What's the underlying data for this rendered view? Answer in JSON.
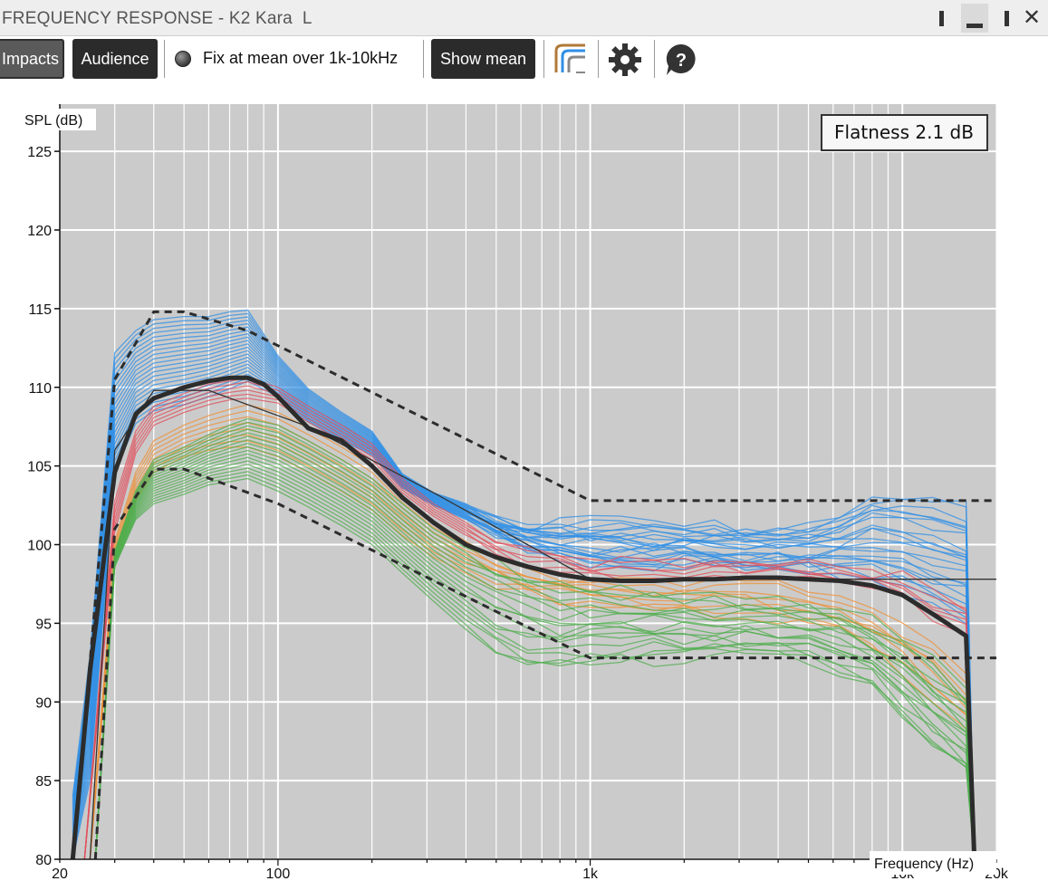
{
  "window": {
    "title": "FREQUENCY RESPONSE - K2 Kara  L",
    "close_label": "✕"
  },
  "toolbar": {
    "impacts_label": "Impacts",
    "audience_label": "Audience",
    "fix_mean_label": "Fix at mean over 1k-10kHz",
    "show_mean_label": "Show mean",
    "icons": [
      "curves-icon",
      "gear-icon",
      "help-icon"
    ],
    "help_glyph": "?"
  },
  "colors": {
    "plot_bg": "#cbcbcb",
    "grid": "#ffffff",
    "blue": "#2f8fe6",
    "red": "#e0505c",
    "orange": "#ee9138",
    "green": "#4fae4e",
    "mean": "#2c2c2c",
    "dashed": "#2c2c2c",
    "button_dark": "#2b2b2b"
  },
  "chart_data": {
    "type": "line",
    "ylabel": "SPL (dB)",
    "xlabel": "Frequency (Hz)",
    "x_scale": "log",
    "xlim": [
      20,
      20000
    ],
    "ylim": [
      80,
      128
    ],
    "x_tick_labels": [
      {
        "value": 20,
        "label": "20"
      },
      {
        "value": 100,
        "label": "100"
      },
      {
        "value": 1000,
        "label": "1k"
      },
      {
        "value": 10000,
        "label": "10k"
      },
      {
        "value": 20000,
        "label": "20k"
      }
    ],
    "y_ticks": [
      80,
      85,
      90,
      95,
      100,
      105,
      110,
      115,
      120,
      125
    ],
    "grid": true,
    "annotation": "Flatness 2.1 dB",
    "annotation_position": "top-right",
    "band_series": [
      {
        "color_key": "blue",
        "count": 22,
        "upper": [
          [
            22,
            84
          ],
          [
            25,
            93
          ],
          [
            30,
            112.2
          ],
          [
            35,
            113.6
          ],
          [
            40,
            114.3
          ],
          [
            50,
            114.5
          ],
          [
            60,
            114.5
          ],
          [
            70,
            114.8
          ],
          [
            80,
            114.9
          ],
          [
            100,
            112
          ],
          [
            125,
            109.9
          ],
          [
            160,
            108.4
          ],
          [
            200,
            107.2
          ],
          [
            250,
            104.5
          ],
          [
            315,
            103.3
          ],
          [
            400,
            102.6
          ],
          [
            500,
            101.8
          ],
          [
            630,
            101.2
          ],
          [
            800,
            101.4
          ],
          [
            1000,
            101.4
          ],
          [
            1250,
            101.5
          ],
          [
            1600,
            101.3
          ],
          [
            2000,
            101.1
          ],
          [
            2500,
            101.2
          ],
          [
            3150,
            101.0
          ],
          [
            4000,
            101.1
          ],
          [
            5000,
            101.3
          ],
          [
            6300,
            102.1
          ],
          [
            8000,
            102.9
          ],
          [
            10000,
            103.0
          ],
          [
            12500,
            102.9
          ],
          [
            16000,
            102.4
          ],
          [
            17000,
            80
          ]
        ],
        "lower": [
          [
            22,
            80
          ],
          [
            25,
            85
          ],
          [
            30,
            104.6
          ],
          [
            35,
            107.7
          ],
          [
            40,
            108.5
          ],
          [
            50,
            108.9
          ],
          [
            60,
            109.4
          ],
          [
            70,
            109.9
          ],
          [
            80,
            110.4
          ],
          [
            100,
            109.4
          ],
          [
            125,
            107.8
          ],
          [
            160,
            106.6
          ],
          [
            200,
            105.7
          ],
          [
            250,
            103.6
          ],
          [
            315,
            102.5
          ],
          [
            400,
            101.6
          ],
          [
            500,
            100.6
          ],
          [
            630,
            99.7
          ],
          [
            800,
            99.3
          ],
          [
            1000,
            98.8
          ],
          [
            1250,
            98.7
          ],
          [
            1600,
            98.6
          ],
          [
            2000,
            98.8
          ],
          [
            2500,
            98.7
          ],
          [
            3150,
            98.6
          ],
          [
            4000,
            98.5
          ],
          [
            5000,
            98.3
          ],
          [
            6300,
            97.9
          ],
          [
            8000,
            97.6
          ],
          [
            10000,
            97.1
          ],
          [
            12500,
            96.3
          ],
          [
            16000,
            95.2
          ],
          [
            17000,
            80
          ]
        ]
      },
      {
        "color_key": "red",
        "count": 6,
        "upper": [
          [
            24,
            80
          ],
          [
            30,
            102.8
          ],
          [
            35,
            107.2
          ],
          [
            40,
            108.8
          ],
          [
            50,
            109.6
          ],
          [
            60,
            110.2
          ],
          [
            70,
            110.4
          ],
          [
            80,
            110.6
          ],
          [
            100,
            110.0
          ],
          [
            125,
            108.8
          ],
          [
            160,
            107.6
          ],
          [
            200,
            106.4
          ],
          [
            250,
            104.2
          ],
          [
            315,
            102.6
          ],
          [
            400,
            101.4
          ],
          [
            500,
            100.4
          ],
          [
            630,
            99.6
          ],
          [
            800,
            99.2
          ],
          [
            1000,
            99.0
          ],
          [
            1250,
            99.0
          ],
          [
            1600,
            98.9
          ],
          [
            2000,
            98.9
          ],
          [
            2500,
            99.0
          ],
          [
            3150,
            99.0
          ],
          [
            4000,
            99.0
          ],
          [
            5000,
            98.9
          ],
          [
            6300,
            98.6
          ],
          [
            8000,
            98.3
          ],
          [
            10000,
            97.9
          ],
          [
            12500,
            97.1
          ],
          [
            16000,
            96.0
          ],
          [
            17000,
            80
          ]
        ],
        "lower": [
          [
            24,
            80
          ],
          [
            30,
            100.8
          ],
          [
            35,
            105.8
          ],
          [
            40,
            107.6
          ],
          [
            50,
            108.4
          ],
          [
            60,
            108.9
          ],
          [
            70,
            109.2
          ],
          [
            80,
            109.3
          ],
          [
            100,
            109.0
          ],
          [
            125,
            107.8
          ],
          [
            160,
            106.6
          ],
          [
            200,
            105.4
          ],
          [
            250,
            103.3
          ],
          [
            315,
            101.8
          ],
          [
            400,
            100.6
          ],
          [
            500,
            99.6
          ],
          [
            630,
            98.8
          ],
          [
            800,
            98.4
          ],
          [
            1000,
            98.2
          ],
          [
            1250,
            98.2
          ],
          [
            1600,
            98.1
          ],
          [
            2000,
            98.1
          ],
          [
            2500,
            98.2
          ],
          [
            3150,
            98.2
          ],
          [
            4000,
            98.1
          ],
          [
            5000,
            98.0
          ],
          [
            6300,
            97.6
          ],
          [
            8000,
            97.2
          ],
          [
            10000,
            96.5
          ],
          [
            12500,
            95.5
          ],
          [
            16000,
            94.4
          ],
          [
            17000,
            80
          ]
        ]
      },
      {
        "color_key": "orange",
        "count": 8,
        "upper": [
          [
            25,
            80
          ],
          [
            30,
            100.2
          ],
          [
            35,
            104.6
          ],
          [
            40,
            106.6
          ],
          [
            50,
            107.6
          ],
          [
            60,
            108.2
          ],
          [
            70,
            108.6
          ],
          [
            80,
            108.9
          ],
          [
            100,
            108.4
          ],
          [
            125,
            107.4
          ],
          [
            160,
            106.2
          ],
          [
            200,
            105.0
          ],
          [
            250,
            103.0
          ],
          [
            315,
            101.4
          ],
          [
            400,
            100.2
          ],
          [
            500,
            99.3
          ],
          [
            630,
            98.5
          ],
          [
            800,
            98.1
          ],
          [
            1000,
            97.9
          ],
          [
            1250,
            97.8
          ],
          [
            1600,
            97.7
          ],
          [
            2000,
            97.6
          ],
          [
            2500,
            97.6
          ],
          [
            3150,
            97.5
          ],
          [
            4000,
            97.4
          ],
          [
            5000,
            97.1
          ],
          [
            6300,
            96.6
          ],
          [
            8000,
            95.9
          ],
          [
            10000,
            94.8
          ],
          [
            12500,
            93.4
          ],
          [
            16000,
            91.6
          ],
          [
            17000,
            80
          ]
        ],
        "lower": [
          [
            25,
            80
          ],
          [
            30,
            98.6
          ],
          [
            35,
            102.8
          ],
          [
            40,
            104.6
          ],
          [
            50,
            105.6
          ],
          [
            60,
            106.0
          ],
          [
            70,
            106.2
          ],
          [
            80,
            106.2
          ],
          [
            100,
            105.6
          ],
          [
            125,
            104.6
          ],
          [
            160,
            103.4
          ],
          [
            200,
            102.2
          ],
          [
            250,
            100.6
          ],
          [
            315,
            99.2
          ],
          [
            400,
            98.2
          ],
          [
            500,
            97.4
          ],
          [
            630,
            96.8
          ],
          [
            800,
            96.4
          ],
          [
            1000,
            96.2
          ],
          [
            1250,
            96.0
          ],
          [
            1600,
            95.9
          ],
          [
            2000,
            95.8
          ],
          [
            2500,
            95.7
          ],
          [
            3150,
            95.6
          ],
          [
            4000,
            95.4
          ],
          [
            5000,
            95.1
          ],
          [
            6300,
            94.5
          ],
          [
            8000,
            93.5
          ],
          [
            10000,
            92.1
          ],
          [
            12500,
            90.4
          ],
          [
            16000,
            88.6
          ],
          [
            17000,
            80
          ]
        ]
      },
      {
        "color_key": "green",
        "count": 18,
        "upper": [
          [
            26,
            80
          ],
          [
            30,
            99.6
          ],
          [
            35,
            103.4
          ],
          [
            40,
            105.4
          ],
          [
            50,
            106.2
          ],
          [
            60,
            107.0
          ],
          [
            70,
            107.6
          ],
          [
            80,
            108.0
          ],
          [
            100,
            107.6
          ],
          [
            125,
            106.6
          ],
          [
            160,
            105.4
          ],
          [
            200,
            104.2
          ],
          [
            250,
            102.6
          ],
          [
            315,
            101.0
          ],
          [
            400,
            99.8
          ],
          [
            500,
            98.8
          ],
          [
            630,
            98.0
          ],
          [
            800,
            97.5
          ],
          [
            1000,
            97.2
          ],
          [
            1250,
            97.0
          ],
          [
            1600,
            96.8
          ],
          [
            2000,
            96.7
          ],
          [
            2500,
            96.6
          ],
          [
            3150,
            96.5
          ],
          [
            4000,
            96.4
          ],
          [
            5000,
            96.2
          ],
          [
            6300,
            95.8
          ],
          [
            8000,
            95.1
          ],
          [
            10000,
            94.0
          ],
          [
            12500,
            92.6
          ],
          [
            16000,
            90.8
          ],
          [
            17000,
            80
          ]
        ],
        "lower": [
          [
            26,
            80
          ],
          [
            30,
            98.6
          ],
          [
            35,
            101.6
          ],
          [
            40,
            102.6
          ],
          [
            50,
            103.2
          ],
          [
            60,
            103.8
          ],
          [
            70,
            104.0
          ],
          [
            80,
            104.2
          ],
          [
            100,
            103.4
          ],
          [
            125,
            102.4
          ],
          [
            160,
            101.2
          ],
          [
            200,
            100.0
          ],
          [
            250,
            98.2
          ],
          [
            315,
            96.4
          ],
          [
            400,
            94.6
          ],
          [
            500,
            93.2
          ],
          [
            630,
            92.3
          ],
          [
            800,
            92.1
          ],
          [
            1000,
            92.4
          ],
          [
            1250,
            92.6
          ],
          [
            1600,
            92.7
          ],
          [
            2000,
            92.8
          ],
          [
            2500,
            92.9
          ],
          [
            3150,
            92.9
          ],
          [
            4000,
            92.8
          ],
          [
            5000,
            92.6
          ],
          [
            6300,
            92.0
          ],
          [
            8000,
            90.9
          ],
          [
            10000,
            89.2
          ],
          [
            12500,
            87.2
          ],
          [
            16000,
            85.5
          ],
          [
            17000,
            80
          ]
        ]
      }
    ],
    "mean": [
      [
        22,
        80
      ],
      [
        25,
        92
      ],
      [
        30,
        104.6
      ],
      [
        35,
        108.3
      ],
      [
        40,
        109.3
      ],
      [
        50,
        110.0
      ],
      [
        60,
        110.4
      ],
      [
        70,
        110.6
      ],
      [
        80,
        110.6
      ],
      [
        90,
        110.2
      ],
      [
        100,
        109.4
      ],
      [
        125,
        107.4
      ],
      [
        160,
        106.6
      ],
      [
        200,
        105.0
      ],
      [
        250,
        103.0
      ],
      [
        315,
        101.4
      ],
      [
        400,
        100.0
      ],
      [
        500,
        99.2
      ],
      [
        630,
        98.6
      ],
      [
        800,
        98.1
      ],
      [
        1000,
        97.8
      ],
      [
        1250,
        97.7
      ],
      [
        1600,
        97.7
      ],
      [
        2000,
        97.8
      ],
      [
        2500,
        97.8
      ],
      [
        3150,
        97.9
      ],
      [
        4000,
        97.9
      ],
      [
        5000,
        97.8
      ],
      [
        6300,
        97.7
      ],
      [
        8000,
        97.4
      ],
      [
        10000,
        96.8
      ],
      [
        12500,
        95.6
      ],
      [
        16000,
        94.2
      ],
      [
        17000,
        80
      ]
    ],
    "target": [
      [
        25,
        80
      ],
      [
        30,
        106
      ],
      [
        40,
        109.8
      ],
      [
        60,
        109.8
      ],
      [
        125,
        107.5
      ],
      [
        315,
        103.3
      ],
      [
        1000,
        97.8
      ],
      [
        20000,
        97.8
      ]
    ],
    "dashed_upper": [
      [
        22,
        80
      ],
      [
        30,
        110.5
      ],
      [
        40,
        114.8
      ],
      [
        50,
        114.8
      ],
      [
        80,
        113.6
      ],
      [
        1000,
        102.8
      ],
      [
        20000,
        102.8
      ]
    ],
    "dashed_lower": [
      [
        26,
        80
      ],
      [
        30,
        101
      ],
      [
        40,
        104.8
      ],
      [
        50,
        104.8
      ],
      [
        100,
        102.6
      ],
      [
        1000,
        92.8
      ],
      [
        20000,
        92.8
      ]
    ]
  }
}
